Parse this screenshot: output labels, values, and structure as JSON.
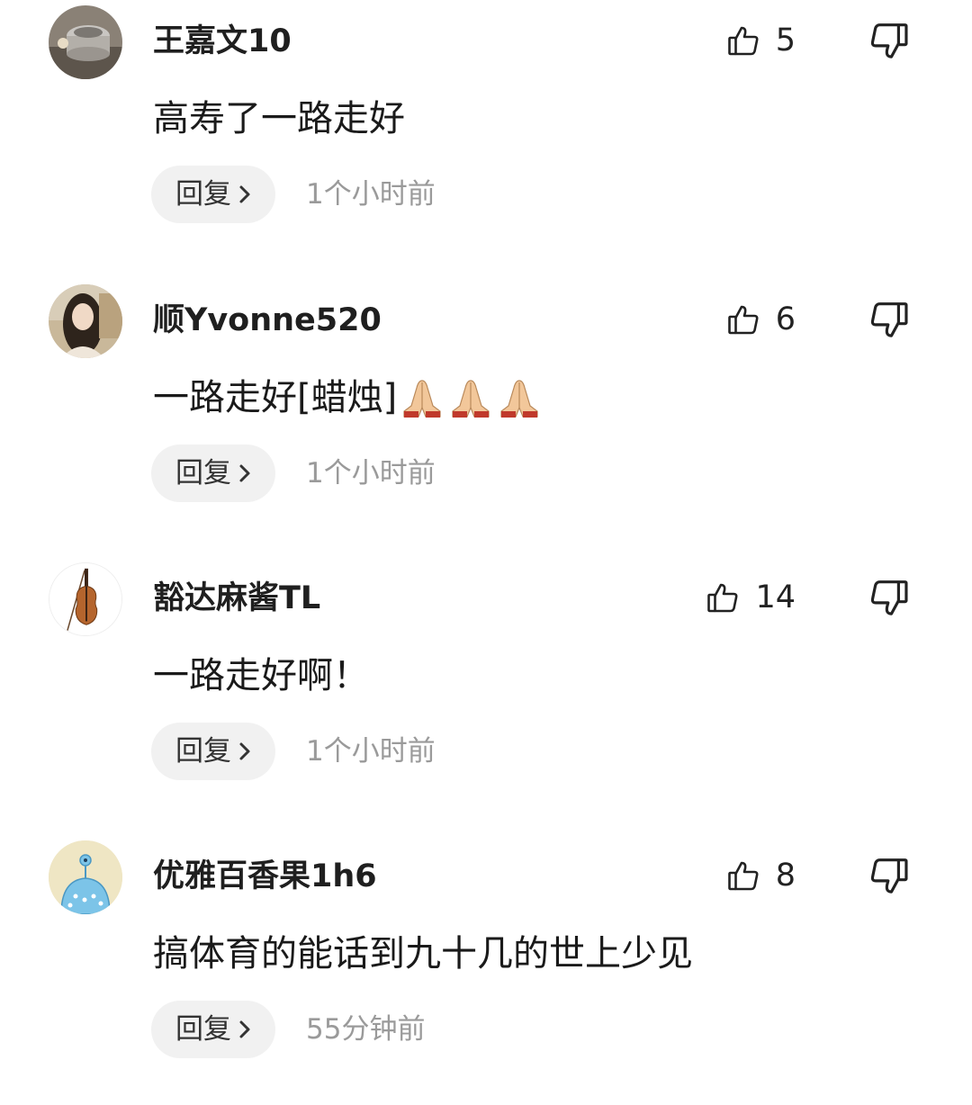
{
  "comments": [
    {
      "username": "王嘉文10",
      "likes": "5",
      "text": "高寿了一路走好",
      "reply_label": "回复",
      "time": "1个小时前",
      "avatar": "round-stove-photo"
    },
    {
      "username": "顺Yvonne520",
      "likes": "6",
      "text": "一路走好[蜡烛]",
      "emoji": "folded-hands-emoji",
      "emoji_count": 3,
      "reply_label": "回复",
      "time": "1个小时前",
      "avatar": "woman-portrait-photo"
    },
    {
      "username": "豁达麻酱TL",
      "likes": "14",
      "text": "一路走好啊！",
      "reply_label": "回复",
      "time": "1个小时前",
      "avatar": "violin-illustration"
    },
    {
      "username": "优雅百香果1h6",
      "likes": "8",
      "text": "搞体育的能话到九十几的世上少见",
      "reply_label": "回复",
      "time": "55分钟前",
      "avatar": "blue-cartoon-creature"
    }
  ],
  "icons": {
    "like": "thumbs-up-icon",
    "dislike": "thumbs-down-icon",
    "reply_arrow": "chevron-right-icon"
  },
  "colors": {
    "pill_bg": "#f1f1f1",
    "timestamp": "#9a9a9a",
    "text": "#1a1a1a"
  }
}
